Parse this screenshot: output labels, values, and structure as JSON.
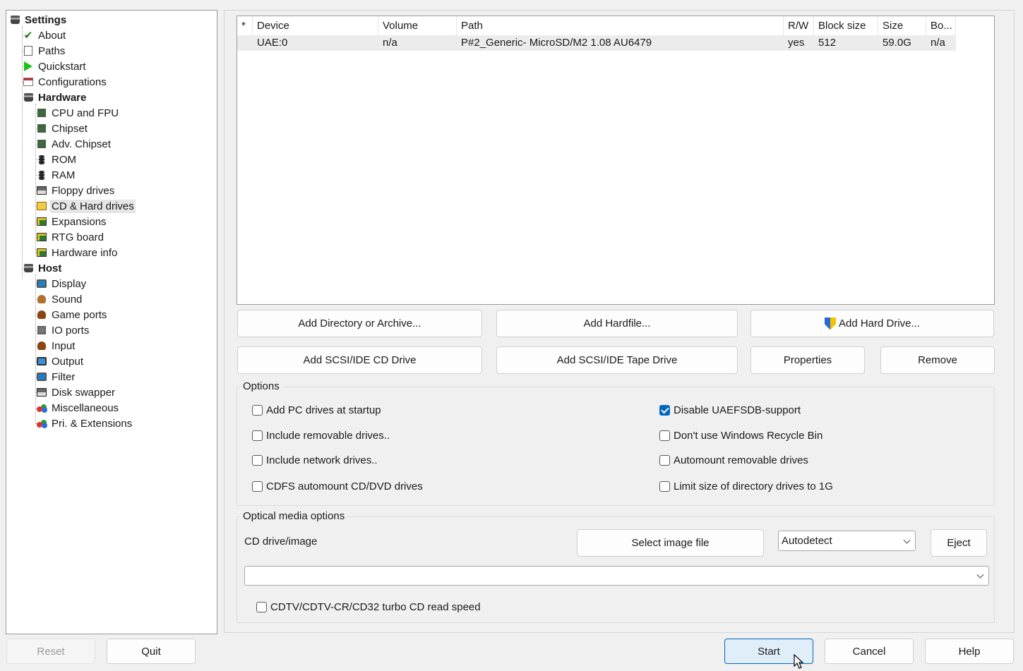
{
  "tree": {
    "settings": "Settings",
    "about": "About",
    "paths": "Paths",
    "quickstart": "Quickstart",
    "configurations": "Configurations",
    "hardware": "Hardware",
    "cpu": "CPU and FPU",
    "chipset": "Chipset",
    "adv_chipset": "Adv. Chipset",
    "rom": "ROM",
    "ram": "RAM",
    "floppy": "Floppy drives",
    "cdhd": "CD & Hard drives",
    "expansions": "Expansions",
    "rtg": "RTG board",
    "hwinfo": "Hardware info",
    "host": "Host",
    "display": "Display",
    "sound": "Sound",
    "gameports": "Game ports",
    "ioports": "IO ports",
    "input": "Input",
    "output": "Output",
    "filter": "Filter",
    "diskswapper": "Disk swapper",
    "misc": "Miscellaneous",
    "pri": "Pri. & Extensions"
  },
  "drivelist": {
    "columns": [
      "*",
      "Device",
      "Volume",
      "Path",
      "R/W",
      "Block size",
      "Size",
      "Bo..."
    ],
    "rows": [
      [
        "",
        "UAE:0",
        "n/a",
        "P#2_Generic- MicroSD/M2 1.08 AU6479",
        "yes",
        "512",
        "59.0G",
        "n/a"
      ]
    ]
  },
  "buttons": {
    "add_dir": "Add Directory or Archive...",
    "add_hardfile": "Add Hardfile...",
    "add_hard_drive": "Add Hard Drive...",
    "add_cd": "Add SCSI/IDE CD Drive",
    "add_tape": "Add SCSI/IDE Tape Drive",
    "properties": "Properties",
    "remove": "Remove"
  },
  "options": {
    "title": "Options",
    "add_pc_drives": "Add PC drives at startup",
    "include_removable": "Include removable drives..",
    "include_network": "Include network drives..",
    "cdfs_automount": "CDFS automount CD/DVD drives",
    "disable_uaefsdb": "Disable UAEFSDB-support",
    "no_recycle": "Don't use Windows Recycle Bin",
    "automount_removable": "Automount removable drives",
    "limit_dir": "Limit size of directory drives to 1G"
  },
  "optical": {
    "title": "Optical media options",
    "cd_label": "CD drive/image",
    "select_image": "Select image file",
    "mode_value": "Autodetect",
    "eject": "Eject",
    "image_path": "",
    "turbo": "CDTV/CDTV-CR/CD32 turbo CD read speed"
  },
  "footer": {
    "reset": "Reset",
    "quit": "Quit",
    "start": "Start",
    "cancel": "Cancel",
    "help": "Help"
  },
  "colors": {
    "accent": "#0067c0",
    "selected_row": "#ececec",
    "start_bg": "#e0eef9"
  }
}
